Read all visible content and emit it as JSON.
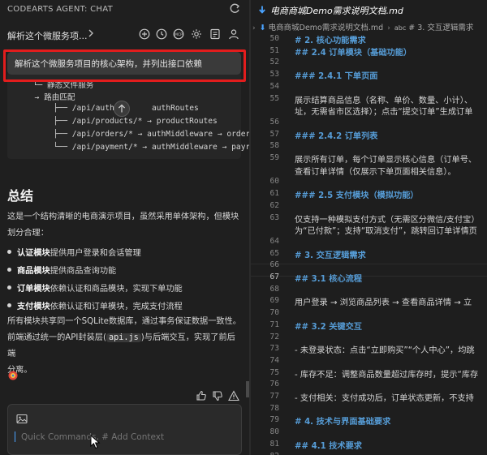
{
  "chat": {
    "header_title": "CODEARTS AGENT: CHAT",
    "tab_title": "解析这个微服务项...",
    "toolbar_icons": [
      "add-icon",
      "history-icon",
      "mcp-icon",
      "settings-icon",
      "document-icon",
      "account-icon"
    ],
    "toolbar_mcp_label": "MCP",
    "user_message": "解析这个微服务项目的核心架构，并列出接口依赖",
    "code_lines": [
      "  └─ 静态文件服务",
      "  → 路由匹配",
      "      ├── /api/auth/",
      "authRoutes",
      "      ├── /api/products/* → productRoutes",
      "      ├── /api/orders/* → authMiddleware → order",
      "      └── /api/payment/* → authMiddleware → payr"
    ],
    "summary_title": "总结",
    "intro_line1": "这是一个结构清晰的电商演示项目，虽然采用单体架构，但模块",
    "intro_line2": "划分合理：",
    "bullets": [
      {
        "bold": "认证模块",
        "text": "提供用户登录和会话管理"
      },
      {
        "bold": "商品模块",
        "text": "提供商品查询功能"
      },
      {
        "bold": "订单模块",
        "text": "依赖认证和商品模块，实现下单功能"
      },
      {
        "bold": "支付模块",
        "text": "依赖认证和订单模块，完成支付流程"
      }
    ],
    "closing_line1": "所有模块共享同一个SQLite数据库，通过事务保证数据一致性。",
    "closing_line2_pre": "前端通过统一的API封装层(",
    "closing_code": "api.js",
    "closing_line2_post": ")与后端交互，实现了前后端",
    "closing_line3": "分离。",
    "input_placeholder": "Quick Commands, # Add Context"
  },
  "editor": {
    "tab_label": "电商商城Demo需求说明文档.md",
    "breadcrumb_file": "电商商城Demo需求说明文档.md",
    "breadcrumb_section": "# 3. 交互逻辑需求",
    "breadcrumb_symbol": "abc",
    "active_line": "67",
    "lines": [
      {
        "no": "50",
        "text": "# 2. 核心功能需求",
        "h": true
      },
      {
        "no": "51",
        "text": "## 2.4 订单模块（基础功能）",
        "h": true
      },
      {
        "no": "52",
        "text": "",
        "h": false
      },
      {
        "no": "53",
        "text": "### 2.4.1 下单页面",
        "h": true
      },
      {
        "no": "54",
        "text": "",
        "h": false
      },
      {
        "no": "55",
        "text": "展示结算商品信息（名称、单价、数量、小计）、",
        "h": false
      },
      {
        "no": "",
        "text": "址，无需省市区选择）；点击“提交订单”生成订单",
        "h": false
      },
      {
        "no": "56",
        "text": "",
        "h": false
      },
      {
        "no": "57",
        "text": "### 2.4.2 订单列表",
        "h": true
      },
      {
        "no": "58",
        "text": "",
        "h": false
      },
      {
        "no": "59",
        "text": "展示所有订单，每个订单显示核心信息（订单号、",
        "h": false
      },
      {
        "no": "",
        "text": "查看订单详情（仅展示下单页面相关信息）。",
        "h": false
      },
      {
        "no": "60",
        "text": "",
        "h": false
      },
      {
        "no": "61",
        "text": "### 2.5 支付模块（模拟功能）",
        "h": true
      },
      {
        "no": "62",
        "text": "",
        "h": false
      },
      {
        "no": "63",
        "text": "仅支持一种模拟支付方式（无需区分微信/支付宝）",
        "h": false
      },
      {
        "no": "",
        "text": "为“已付款”；支持“取消支付”，跳转回订单详情页",
        "h": false
      },
      {
        "no": "64",
        "text": "",
        "h": false
      },
      {
        "no": "65",
        "text": "# 3. 交互逻辑需求",
        "h": true
      },
      {
        "no": "66",
        "text": "",
        "h": false
      },
      {
        "no": "67",
        "text": "## 3.1 核心流程",
        "h": true
      },
      {
        "no": "68",
        "text": "",
        "h": false
      },
      {
        "no": "69",
        "text": "用户登录 → 浏览商品列表 → 查看商品详情 → 立",
        "h": false
      },
      {
        "no": "70",
        "text": "",
        "h": false
      },
      {
        "no": "71",
        "text": "## 3.2 关键交互",
        "h": true
      },
      {
        "no": "72",
        "text": "",
        "h": false
      },
      {
        "no": "73",
        "text": "- 未登录状态：点击“立即购买”“个人中心”，均跳",
        "h": false
      },
      {
        "no": "74",
        "text": "",
        "h": false
      },
      {
        "no": "75",
        "text": "- 库存不足：调整商品数量超过库存时，提示“库存",
        "h": false
      },
      {
        "no": "76",
        "text": "",
        "h": false
      },
      {
        "no": "77",
        "text": "- 支付相关：支付成功后，订单状态更新，不支持",
        "h": false
      },
      {
        "no": "78",
        "text": "",
        "h": false
      },
      {
        "no": "79",
        "text": "# 4. 技术与界面基础要求",
        "h": true
      },
      {
        "no": "80",
        "text": "",
        "h": false
      },
      {
        "no": "81",
        "text": "## 4.1 技术要求",
        "h": true
      },
      {
        "no": "82",
        "text": "",
        "h": false
      }
    ]
  },
  "colors": {
    "selection_box": "#e21d1d",
    "heading": "#569cd6",
    "accent": "#4aa3ff"
  }
}
